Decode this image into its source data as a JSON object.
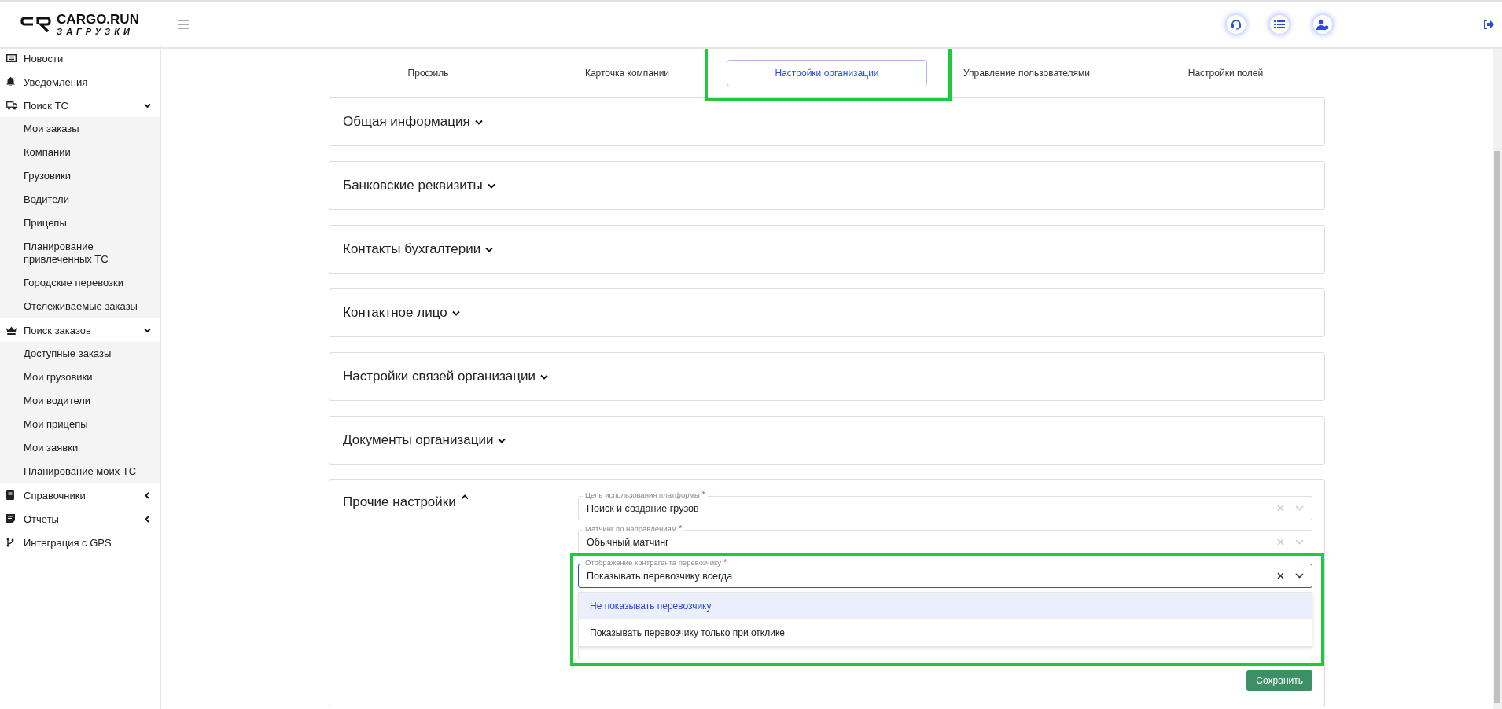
{
  "logo": {
    "name": "CARGO.RUN",
    "tagline": "ЗАГРУЗКИ"
  },
  "sidebar": {
    "items": [
      {
        "label": "Новости"
      },
      {
        "label": "Уведомления"
      },
      {
        "label": "Поиск ТС",
        "expanded": true,
        "children": [
          {
            "label": "Мои заказы"
          },
          {
            "label": "Компании"
          },
          {
            "label": "Грузовики"
          },
          {
            "label": "Водители"
          },
          {
            "label": "Прицепы"
          },
          {
            "label": "Планирование привлеченных ТС"
          },
          {
            "label": "Городские перевозки"
          },
          {
            "label": "Отслеживаемые заказы"
          }
        ]
      },
      {
        "label": "Поиск заказов",
        "expanded": true,
        "children": [
          {
            "label": "Доступные заказы"
          },
          {
            "label": "Мои грузовики"
          },
          {
            "label": "Мои водители"
          },
          {
            "label": "Мои прицепы"
          },
          {
            "label": "Мои заявки"
          },
          {
            "label": "Планирование моих ТС"
          }
        ]
      },
      {
        "label": "Справочники",
        "expanded": false
      },
      {
        "label": "Отчеты",
        "expanded": false
      },
      {
        "label": "Интеграция с GPS"
      }
    ]
  },
  "tabs": [
    {
      "label": "Профиль",
      "selected": false
    },
    {
      "label": "Карточка компании",
      "selected": false
    },
    {
      "label": "Настройки организации",
      "selected": true
    },
    {
      "label": "Управление пользователями",
      "selected": false
    },
    {
      "label": "Настройки полей",
      "selected": false
    }
  ],
  "sections": [
    {
      "title": "Общая информация",
      "expanded": false
    },
    {
      "title": "Банковские реквизиты",
      "expanded": false
    },
    {
      "title": "Контакты бухгалтерии",
      "expanded": false
    },
    {
      "title": "Контактное лицо",
      "expanded": false
    },
    {
      "title": "Настройки связей организации",
      "expanded": false
    },
    {
      "title": "Документы организации",
      "expanded": false
    },
    {
      "title": "Прочие настройки",
      "expanded": true
    }
  ],
  "settings": {
    "fields": [
      {
        "label": "Цель использования платформы",
        "required_mark": "*",
        "value": "Поиск и создание грузов",
        "open": false
      },
      {
        "label": "Матчинг по направлениям",
        "required_mark": "*",
        "value": "Обычный матчинг",
        "open": false
      },
      {
        "label": "Отображение контрагента перевозчику",
        "required_mark": "*",
        "value": "Показывать перевозчику всегда",
        "open": true,
        "options": [
          {
            "label": "Не показывать перевозчику",
            "highlighted": true
          },
          {
            "label": "Показывать перевозчику только при отклике",
            "highlighted": false
          }
        ]
      }
    ],
    "save_button": {
      "label": "Сохранить",
      "disabled": true
    }
  }
}
